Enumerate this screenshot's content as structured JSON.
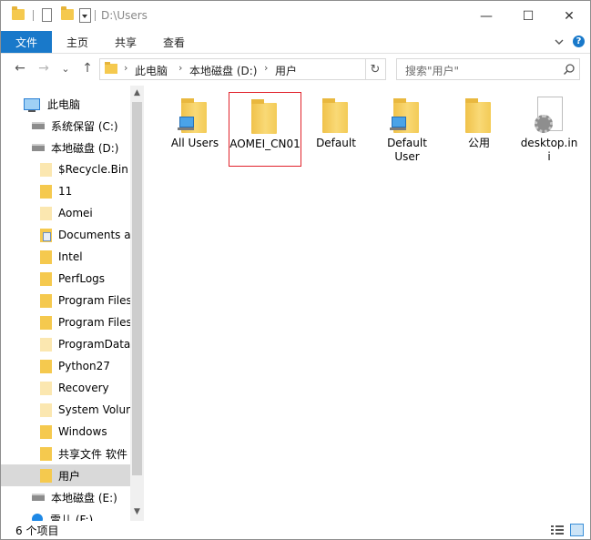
{
  "window": {
    "title": "D:\\Users",
    "controls": {
      "minimize": "—",
      "maximize": "☐",
      "close": "✕"
    }
  },
  "ribbon": {
    "tabs": [
      "文件",
      "主页",
      "共享",
      "查看"
    ],
    "help": "?"
  },
  "nav": {
    "back": "←",
    "forward": "→",
    "recent": "⌄",
    "up": "↑",
    "breadcrumb": [
      "此电脑",
      "本地磁盘 (D:)",
      "用户"
    ],
    "refresh": "↻",
    "search_placeholder": "搜索\"用户\""
  },
  "tree": [
    {
      "label": "此电脑",
      "icon": "pc-icon"
    },
    {
      "label": "系统保留 (C:)",
      "icon": "drive-icon"
    },
    {
      "label": "本地磁盘 (D:)",
      "icon": "drive-icon"
    },
    {
      "label": "$Recycle.Bin",
      "icon": "folder-icon"
    },
    {
      "label": "11",
      "icon": "folder-icon"
    },
    {
      "label": "Aomei",
      "icon": "folder-icon"
    },
    {
      "label": "Documents ar",
      "icon": "documents-icon"
    },
    {
      "label": "Intel",
      "icon": "folder-icon"
    },
    {
      "label": "PerfLogs",
      "icon": "folder-icon"
    },
    {
      "label": "Program Files",
      "icon": "folder-icon"
    },
    {
      "label": "Program Files",
      "icon": "folder-icon"
    },
    {
      "label": "ProgramData",
      "icon": "folder-icon"
    },
    {
      "label": "Python27",
      "icon": "folder-icon"
    },
    {
      "label": "Recovery",
      "icon": "folder-icon"
    },
    {
      "label": "System Volun",
      "icon": "folder-icon"
    },
    {
      "label": "Windows",
      "icon": "folder-icon"
    },
    {
      "label": "共享文件 软件",
      "icon": "folder-icon"
    },
    {
      "label": "用户",
      "icon": "folder-icon",
      "selected": true
    },
    {
      "label": "本地磁盘 (E:)",
      "icon": "drive-icon"
    },
    {
      "label": "雲儿 (F:)",
      "icon": "cloud-drive-icon"
    }
  ],
  "files": [
    {
      "label": "All Users",
      "icon": "network-folder-icon"
    },
    {
      "label": "AOMEI_CN01",
      "icon": "folder-icon",
      "selected": true
    },
    {
      "label": "Default",
      "icon": "folder-icon"
    },
    {
      "label": "Default User",
      "icon": "network-folder-icon"
    },
    {
      "label": "公用",
      "icon": "folder-icon"
    },
    {
      "label": "desktop.ini",
      "icon": "settings-file-icon"
    }
  ],
  "status": {
    "item_count": "6 个项目"
  },
  "colors": {
    "accent": "#1979ca",
    "folder": "#f5c94e",
    "selection_border": "#e1232c",
    "tree_selected": "#d9d9d9"
  }
}
